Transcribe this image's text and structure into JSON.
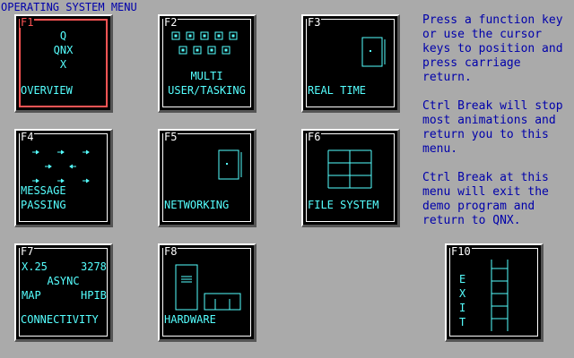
{
  "title": "OPERATING SYSTEM MENU",
  "colors": {
    "background": "#aaaaaa",
    "tile": "#000000",
    "accent": "#55ffff",
    "selected": "#ff5555",
    "text": "#0000aa"
  },
  "tiles": {
    "f1": {
      "key": "F1",
      "lines": [
        "Q",
        "QNX",
        "X"
      ],
      "label": "OVERVIEW"
    },
    "f2": {
      "key": "F2",
      "label": "MULTI\nUSER/TASKING"
    },
    "f3": {
      "key": "F3",
      "label": "REAL TIME"
    },
    "f4": {
      "key": "F4",
      "label": "MESSAGE\nPASSING"
    },
    "f5": {
      "key": "F5",
      "label": "NETWORKING"
    },
    "f6": {
      "key": "F6",
      "label": "FILE SYSTEM"
    },
    "f7": {
      "key": "F7",
      "x25": "X.25",
      "n3278": "3278",
      "async": "ASYNC",
      "map": "MAP",
      "hpib": "HPIB",
      "label": "CONNECTIVITY"
    },
    "f8": {
      "key": "F8",
      "label": "HARDWARE"
    },
    "f10": {
      "key": "F10",
      "vertical": [
        "E",
        "X",
        "I",
        "T"
      ]
    }
  },
  "help": {
    "p1": "Press a function key or use the cursor keys to position and press carriage return.",
    "p2": "Ctrl Break will stop most animations and return you to this menu.",
    "p3": "Ctrl Break at this menu will exit the demo program and return to QNX."
  }
}
